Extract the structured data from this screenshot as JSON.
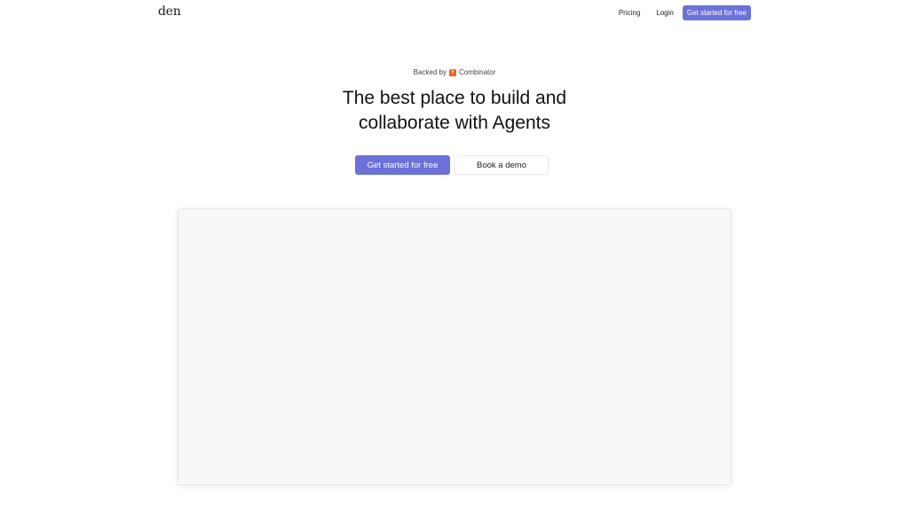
{
  "nav": {
    "logo": "den",
    "pricing": "Pricing",
    "login": "Login",
    "cta": "Get started for free"
  },
  "hero": {
    "backed_prefix": "Backed by",
    "yc_letter": "Y",
    "backed_suffix": "Combinator",
    "headline_line1": "The best place to build and",
    "headline_line2": "collaborate with Agents",
    "primary_cta": "Get started for free",
    "secondary_cta": "Book a demo"
  },
  "colors": {
    "accent": "#6c72d9",
    "yc_orange": "#f26522"
  }
}
